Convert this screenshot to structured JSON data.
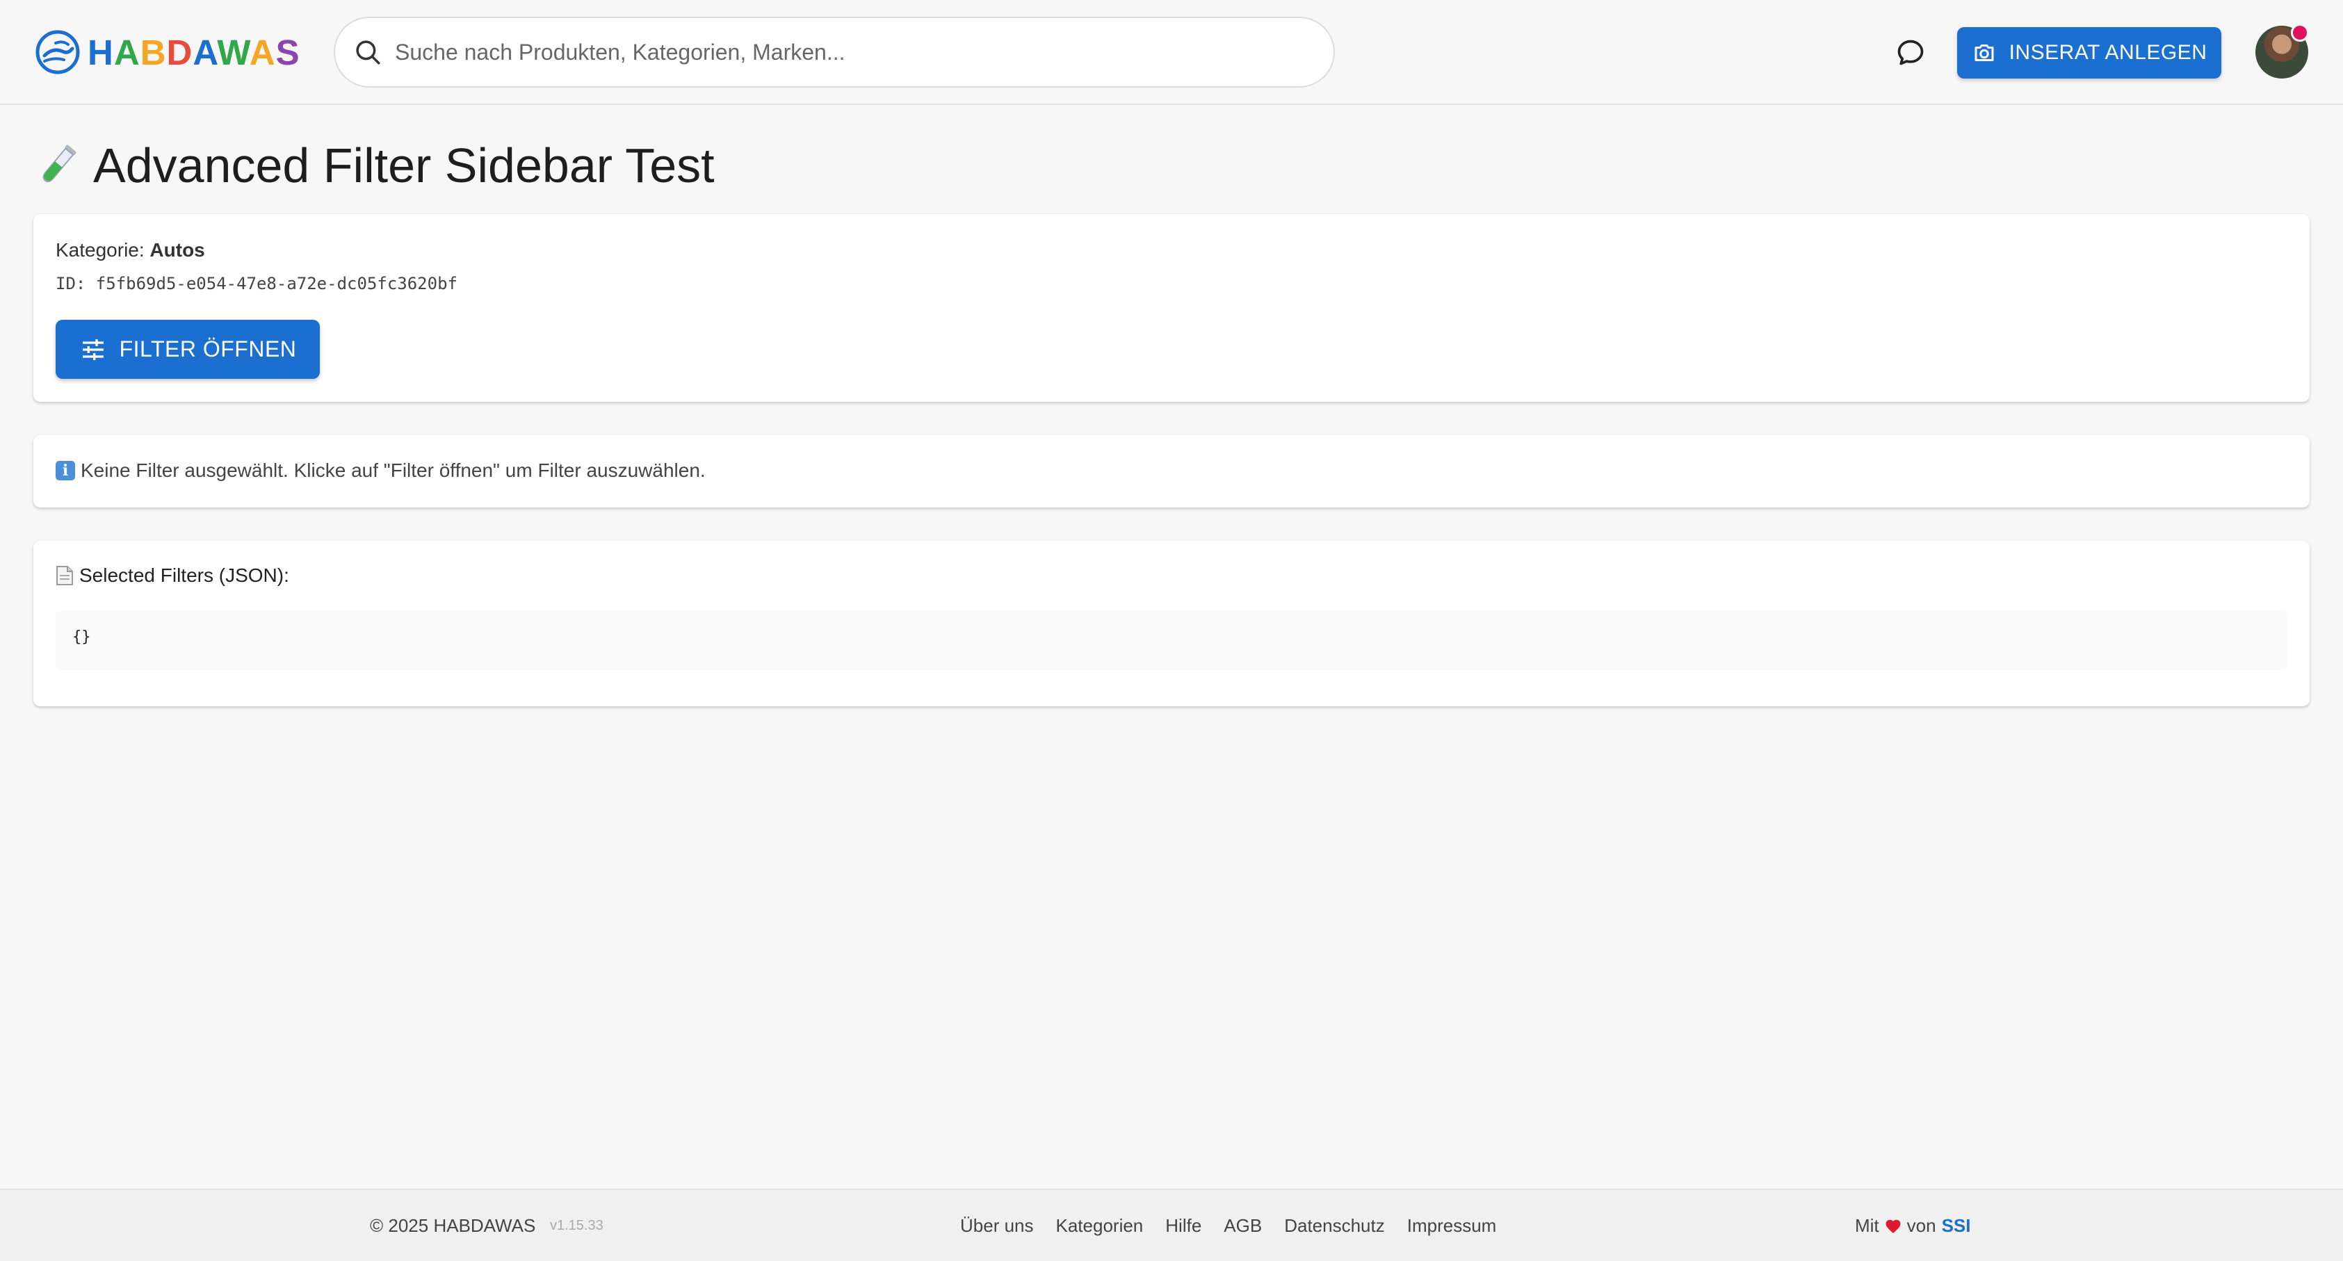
{
  "header": {
    "logo_text": "HABDAWAS",
    "logo_letter_colors": [
      "#1a6fd1",
      "#2ea84a",
      "#f5a623",
      "#e84c3d",
      "#1a6fd1",
      "#2ea84a",
      "#f5a623",
      "#8e44ad"
    ],
    "search_placeholder": "Suche nach Produkten, Kategorien, Marken...",
    "cta_label": "INSERAT ANLEGEN"
  },
  "page": {
    "title": "Advanced Filter Sidebar Test"
  },
  "category_card": {
    "category_label": "Kategorie: ",
    "category_value": "Autos",
    "id_text": "ID: f5fb69d5-e054-47e8-a72e-dc05fc3620bf",
    "filter_button_label": "FILTER ÖFFNEN"
  },
  "info_card": {
    "message": "Keine Filter ausgewählt. Klicke auf \"Filter öffnen\" um Filter auszuwählen."
  },
  "json_card": {
    "title": "Selected Filters (JSON):",
    "content": "{}"
  },
  "footer": {
    "copyright": "© 2025 HABDAWAS",
    "version": "v1.15.33",
    "links": [
      "Über uns",
      "Kategorien",
      "Hilfe",
      "AGB",
      "Datenschutz",
      "Impressum"
    ],
    "made_by_prefix": "Mit",
    "made_by_middle": "von",
    "made_by_brand": "SSI"
  },
  "colors": {
    "primary": "#1a6fd1",
    "notification": "#e0115f",
    "heart": "#e0182d"
  }
}
